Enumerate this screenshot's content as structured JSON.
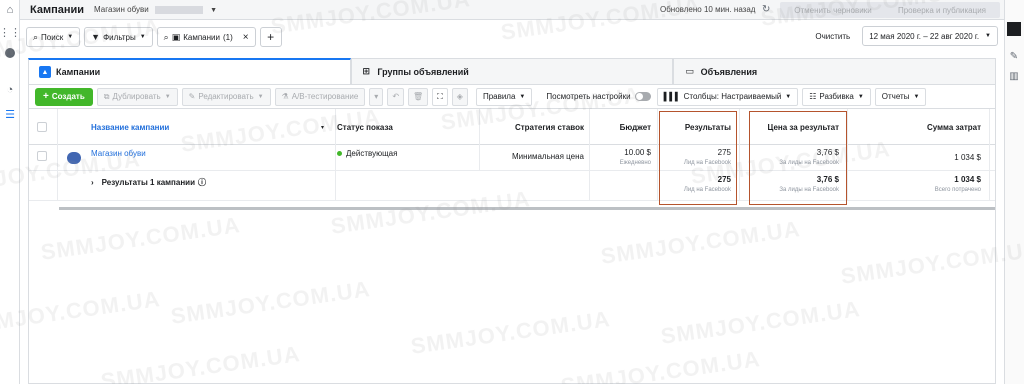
{
  "header": {
    "title": "Кампании",
    "account_name": "Магазин обуви",
    "updated": "Обновлено 10 мин. назад",
    "discard_label": "Отменить черновики",
    "review_label": "Проверка и публикация"
  },
  "search": {
    "search_label": "Поиск",
    "filters_label": "Фильтры",
    "campaigns_chip": "Кампании",
    "campaigns_count": "(1)",
    "clear_label": "Очистить",
    "date_range": "12 мая 2020 г. – 22 авг 2020 г."
  },
  "tabs": [
    {
      "label": "Кампании"
    },
    {
      "label": "Группы объявлений"
    },
    {
      "label": "Объявления"
    }
  ],
  "toolbar": {
    "create_label": "Создать",
    "duplicate_label": "Дублировать",
    "edit_label": "Редактировать",
    "ab_label": "A/B-тестирование",
    "rules_label": "Правила",
    "view_settings_label": "Посмотреть настройки",
    "columns_label": "Столбцы: Настраиваемый",
    "breakdown_label": "Разбивка",
    "reports_label": "Отчеты"
  },
  "table": {
    "headers": {
      "name": "Название кампании",
      "status": "Статус показа",
      "strategy": "Стратегия ставок",
      "budget": "Бюджет",
      "results": "Результаты",
      "cpr": "Цена за результат",
      "spend": "Сумма затрат"
    },
    "rows": [
      {
        "name": "Магазин обуви",
        "status": "Действующая",
        "strategy": "Минимальная цена",
        "budget": "10.00 $",
        "budget_sub": "Ежедневно",
        "results": "275",
        "results_sub": "Лид на Facebook",
        "cpr": "3,76 $",
        "cpr_sub": "За лиды на Facebook",
        "spend": "1 034 $"
      }
    ],
    "summary": {
      "label": "Результаты 1 кампании",
      "info_icon": "info-icon",
      "results": "275",
      "results_sub": "Лид на Facebook",
      "cpr": "3,76 $",
      "cpr_sub": "За лиды на Facebook",
      "spend": "1 034 $",
      "spend_sub": "Всего потрачено"
    }
  },
  "watermark": "SMMJOY.COM.UA",
  "colors": {
    "accent": "#1877f2",
    "create": "#42b72a",
    "highlight": "#b5542d"
  }
}
